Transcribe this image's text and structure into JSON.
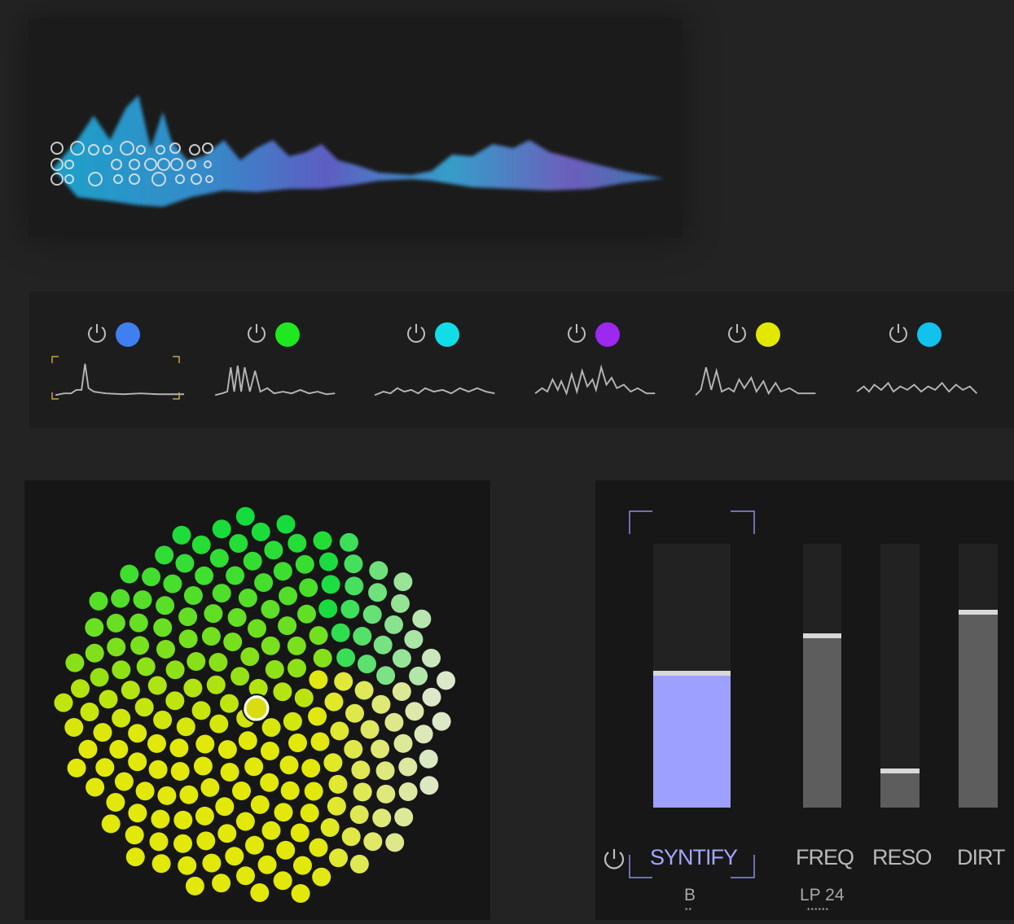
{
  "colors": {
    "background": "#232323",
    "accent": "#9ea0ff",
    "fader_fill": "#5d5d5d",
    "handle": "#d8d8d8"
  },
  "slots": [
    {
      "icon": "power-icon",
      "color": "#3f7ff2",
      "selected": true
    },
    {
      "icon": "power-icon",
      "color": "#1ee81e",
      "selected": false
    },
    {
      "icon": "power-icon",
      "color": "#12dde6",
      "selected": false
    },
    {
      "icon": "power-icon",
      "color": "#9d28f0",
      "selected": false
    },
    {
      "icon": "power-icon",
      "color": "#e2e800",
      "selected": false
    },
    {
      "icon": "power-icon",
      "color": "#10c2ec",
      "selected": false
    }
  ],
  "filter": {
    "mode_label": "SYNTIFY",
    "mode_value": "B",
    "mode_value_pips": "••",
    "type_value": "LP 24",
    "type_value_pips": "••••••",
    "faders": [
      {
        "label": "SYNTIFY",
        "level": 0.51,
        "accent": true
      },
      {
        "label": "FREQ",
        "level": 0.65,
        "accent": false
      },
      {
        "label": "RESO",
        "level": 0.14,
        "accent": false
      },
      {
        "label": "DIRT",
        "level": 0.74,
        "accent": false
      }
    ]
  }
}
